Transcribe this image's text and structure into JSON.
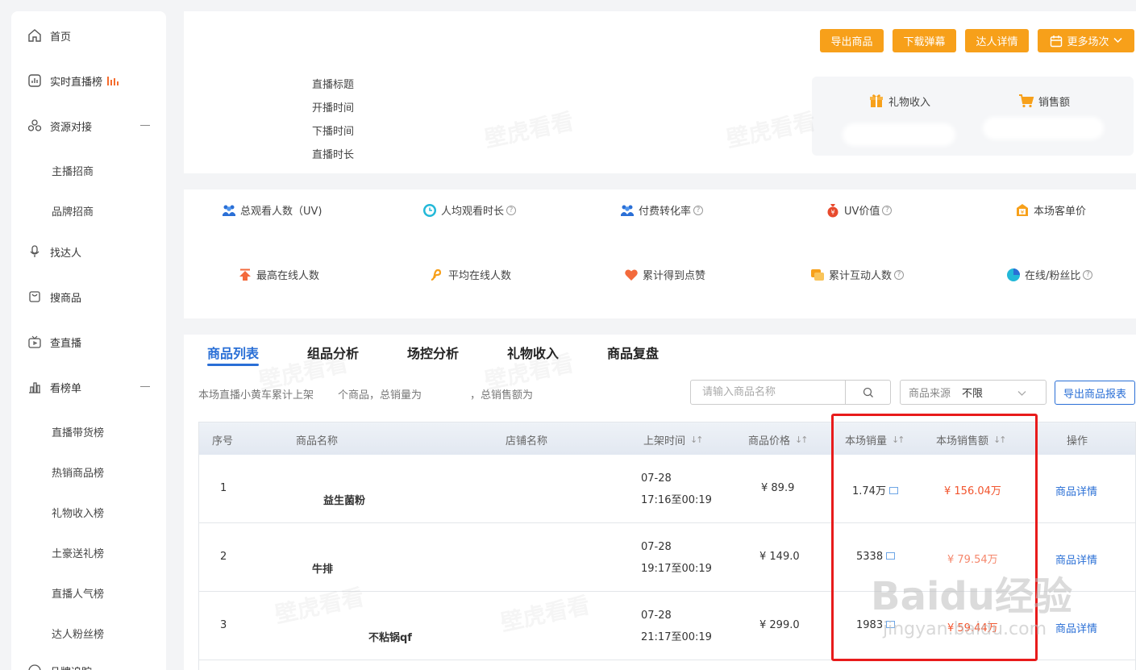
{
  "sidebar": {
    "items": [
      {
        "label": "首页",
        "icon": "home-icon"
      },
      {
        "label": "实时直播榜",
        "icon": "chart-box-icon"
      },
      {
        "label": "资源对接",
        "icon": "resource-icon"
      },
      {
        "label": "找达人",
        "icon": "microphone-icon"
      },
      {
        "label": "搜商品",
        "icon": "shopping-bag-icon"
      },
      {
        "label": "查直播",
        "icon": "tv-icon"
      },
      {
        "label": "看榜单",
        "icon": "bar-chart-icon"
      }
    ],
    "resource_sub": [
      "主播招商",
      "品牌招商"
    ],
    "ranking_sub": [
      "直播带货榜",
      "热销商品榜",
      "礼物收入榜",
      "土豪送礼榜",
      "直播人气榜",
      "达人粉丝榜"
    ],
    "partial_item": "品牌追踪"
  },
  "header": {
    "meta_labels": [
      "直播标题",
      "开播时间",
      "下播时间",
      "直播时长"
    ],
    "buttons": {
      "export_goods": "导出商品",
      "download_danmaku": "下载弹幕",
      "talent_detail": "达人详情",
      "more_sessions": "更多场次"
    },
    "income": {
      "gift_label": "礼物收入",
      "sales_label": "销售额"
    }
  },
  "stats": {
    "row1": [
      "总观看人数（UV)",
      "人均观看时长",
      "付费转化率",
      "UV价值",
      "本场客单价"
    ],
    "row2": [
      "最高在线人数",
      "平均在线人数",
      "累计得到点赞",
      "累计互动人数",
      "在线/粉丝比"
    ]
  },
  "tabs": [
    "商品列表",
    "组品分析",
    "场控分析",
    "礼物收入",
    "商品复盘"
  ],
  "toolbar": {
    "summary_a": "本场直播小黄车累计上架",
    "summary_b": "个商品，总销量为",
    "summary_c": "，总销售额为",
    "search_placeholder": "请输入商品名称",
    "source_label": "商品来源",
    "source_value": "不限",
    "export_report": "导出商品报表"
  },
  "table": {
    "headers": {
      "index": "序号",
      "name": "商品名称",
      "shop": "店铺名称",
      "listed_time": "上架时间",
      "price": "商品价格",
      "sales": "本场销量",
      "revenue": "本场销售额",
      "action": "操作"
    },
    "rows": [
      {
        "index": "1",
        "name": "益生菌粉",
        "date": "07-28",
        "time": "17:16至00:19",
        "price": "¥ 89.9",
        "sales": "1.74万",
        "revenue": "¥ 156.04万",
        "action": "商品详情"
      },
      {
        "index": "2",
        "name": "牛排",
        "date": "07-28",
        "time": "19:17至00:19",
        "price": "¥ 149.0",
        "sales": "5338",
        "revenue": "¥ 79.54万",
        "action": "商品详情"
      },
      {
        "index": "3",
        "name": "不粘锅qf",
        "date": "07-28",
        "time": "21:17至00:19",
        "price": "¥ 299.0",
        "sales": "1983",
        "revenue": "¥ 59.44万",
        "action": "商品详情"
      }
    ]
  },
  "watermark": {
    "brand": "壁虎看看",
    "baidu_logo": "Baidu经验",
    "baidu_url": "jingyan.baidu.com"
  },
  "colors": {
    "accent": "#2a6fd6",
    "orange_button": "#f7a01a",
    "revenue_red": "#f2542d",
    "highlight_red": "#e81b1b"
  }
}
